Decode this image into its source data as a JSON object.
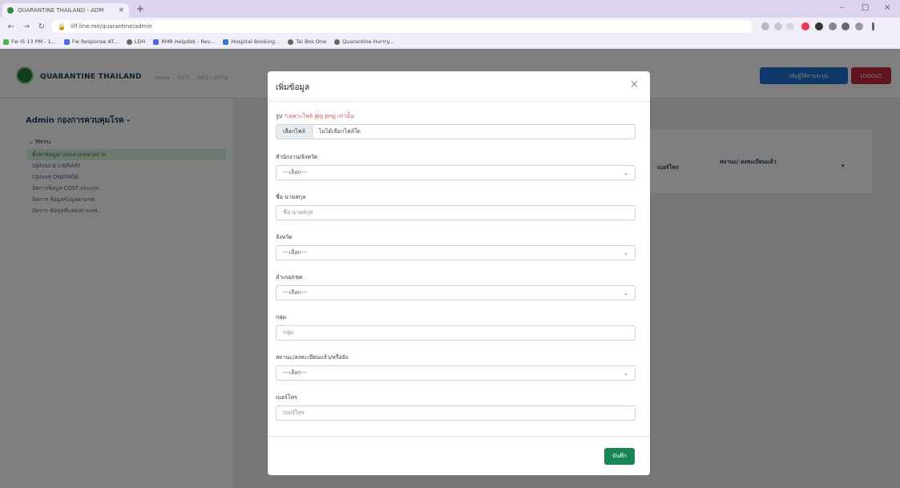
{
  "browser": {
    "tab_title": "QUARANTINE THAILAND - ADM",
    "tab_close": "×",
    "new_tab": "+",
    "url": "liff.line.me/quarantine/admin",
    "window_controls": [
      "–",
      "□",
      "×"
    ],
    "bookmarks": [
      "Fw IS 13 PM - 1...",
      "Fw Response AT...",
      "LDH",
      "RMR Helpdsk - Rev...",
      "Hospital Booking...",
      "Tai Bos One",
      "Quarantine Hurrry..."
    ]
  },
  "app": {
    "brand": "QUARANTINE THAILAND",
    "nav_links": [
      "Home",
      "DCT",
      "ASQ / OSTQ"
    ],
    "add_user_button": "เพิ่มผู้ใช้งานระบบ",
    "logout_button": "LOGOUT",
    "sidebar": {
      "title": "Admin กองการควบคุมโรค -",
      "menu_label": "Menu",
      "items": [
        "ตั้งค่าข้อมูล/ แยกตามหน่วยงาน",
        "Upload E-LIBRARY",
        "Upload ONEPAGE",
        "จัดการข้อมูล COST ประเภท",
        "จัดการ ข้อมูลข้อมูลตามรพ.",
        "จัดการ ข้อมูลที่แสดงตามรพ."
      ]
    },
    "table_headers": [
      "เบอร์โทร",
      "สถานะ/ ลงทะเบียนแล้ว"
    ],
    "sort_icon": "▾"
  },
  "modal": {
    "title": "เพิ่มข้อมูล",
    "close": "×",
    "image_label": "รูป",
    "image_hint": "*เฉพาะไฟล์ jpg png เท่านั้น",
    "file_button": "เลือกไฟล์",
    "file_status": "ไม่ได้เลือกไฟล์ใด",
    "fields": {
      "agency_label": "สำนักงาน/จังหวัด",
      "agency_value": "---เลือก---",
      "name_label": "ชื่อ นามสกุล",
      "name_placeholder": "ชื่อ นามสกุล",
      "province_label": "จังหวัด",
      "province_value": "---เลือก---",
      "district_label": "อำเภอ/เขต",
      "district_value": "---เลือก---",
      "group_label": "กลุ่ม",
      "group_placeholder": "กลุ่ม",
      "status_label": "สถานะ/ลงทะเบียนแล้ว/หรือยัง",
      "status_value": "---เลือก---",
      "phone_label": "เบอร์โทร",
      "phone_placeholder": "เบอร์โทร"
    },
    "save_button": "บันทึก"
  }
}
